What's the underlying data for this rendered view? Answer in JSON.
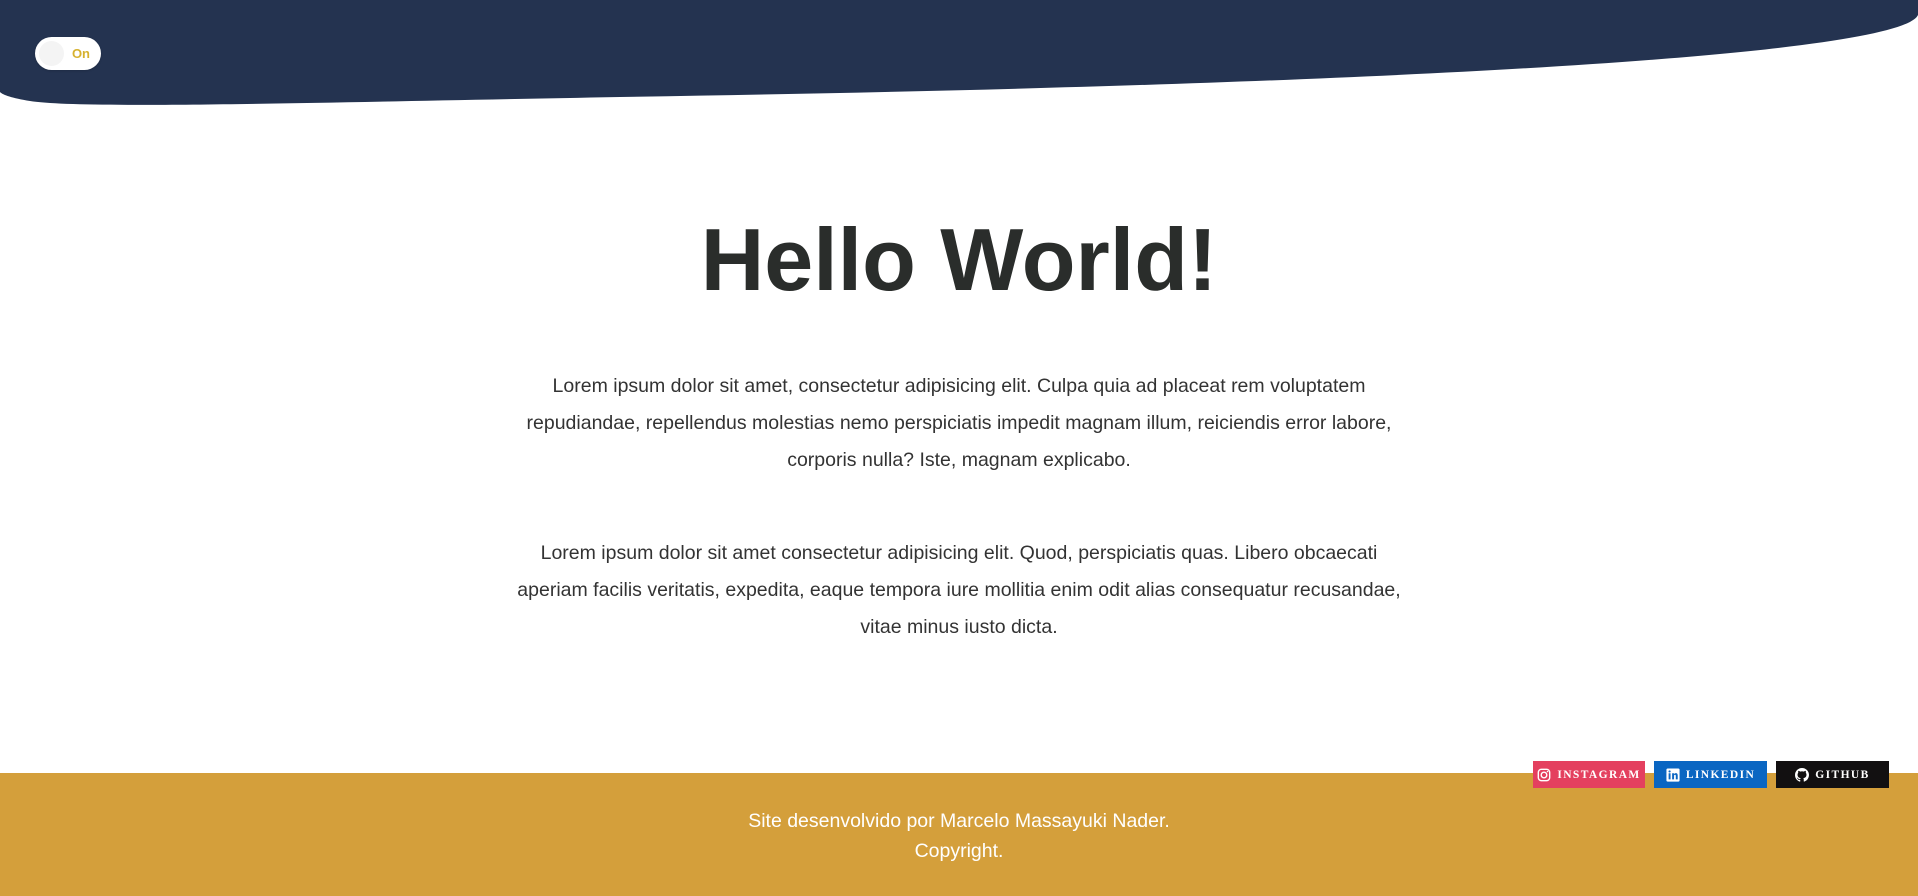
{
  "theme": {
    "header_color": "#243350",
    "footer_color": "#d49f3b",
    "title_color": "#2a2d2b",
    "text_color": "#333333",
    "toggle_accent": "#d6b12f"
  },
  "header": {
    "toggle": {
      "label": "On",
      "state": "on"
    }
  },
  "main": {
    "title": "Hello World!",
    "paragraphs": [
      "Lorem ipsum dolor sit amet, consectetur adipisicing elit. Culpa quia ad placeat rem voluptatem repudiandae, repellendus molestias nemo perspiciatis impedit magnam illum, reiciendis error labore, corporis nulla? Iste, magnam explicabo.",
      "Lorem ipsum dolor sit amet consectetur adipisicing elit. Quod, perspiciatis quas. Libero obcaecati aperiam facilis veritatis, expedita, eaque tempora iure mollitia enim odit alias consequatur recusandae, vitae minus iusto dicta."
    ]
  },
  "social": [
    {
      "label": "Instagram",
      "icon": "instagram-icon",
      "color": "#e4405f"
    },
    {
      "label": "LinkedIn",
      "icon": "linkedin-icon",
      "color": "#0a66c2"
    },
    {
      "label": "GitHub",
      "icon": "github-icon",
      "color": "#121011"
    }
  ],
  "footer": {
    "line1": "Site desenvolvido por Marcelo Massayuki Nader.",
    "line2": "Copyright."
  }
}
